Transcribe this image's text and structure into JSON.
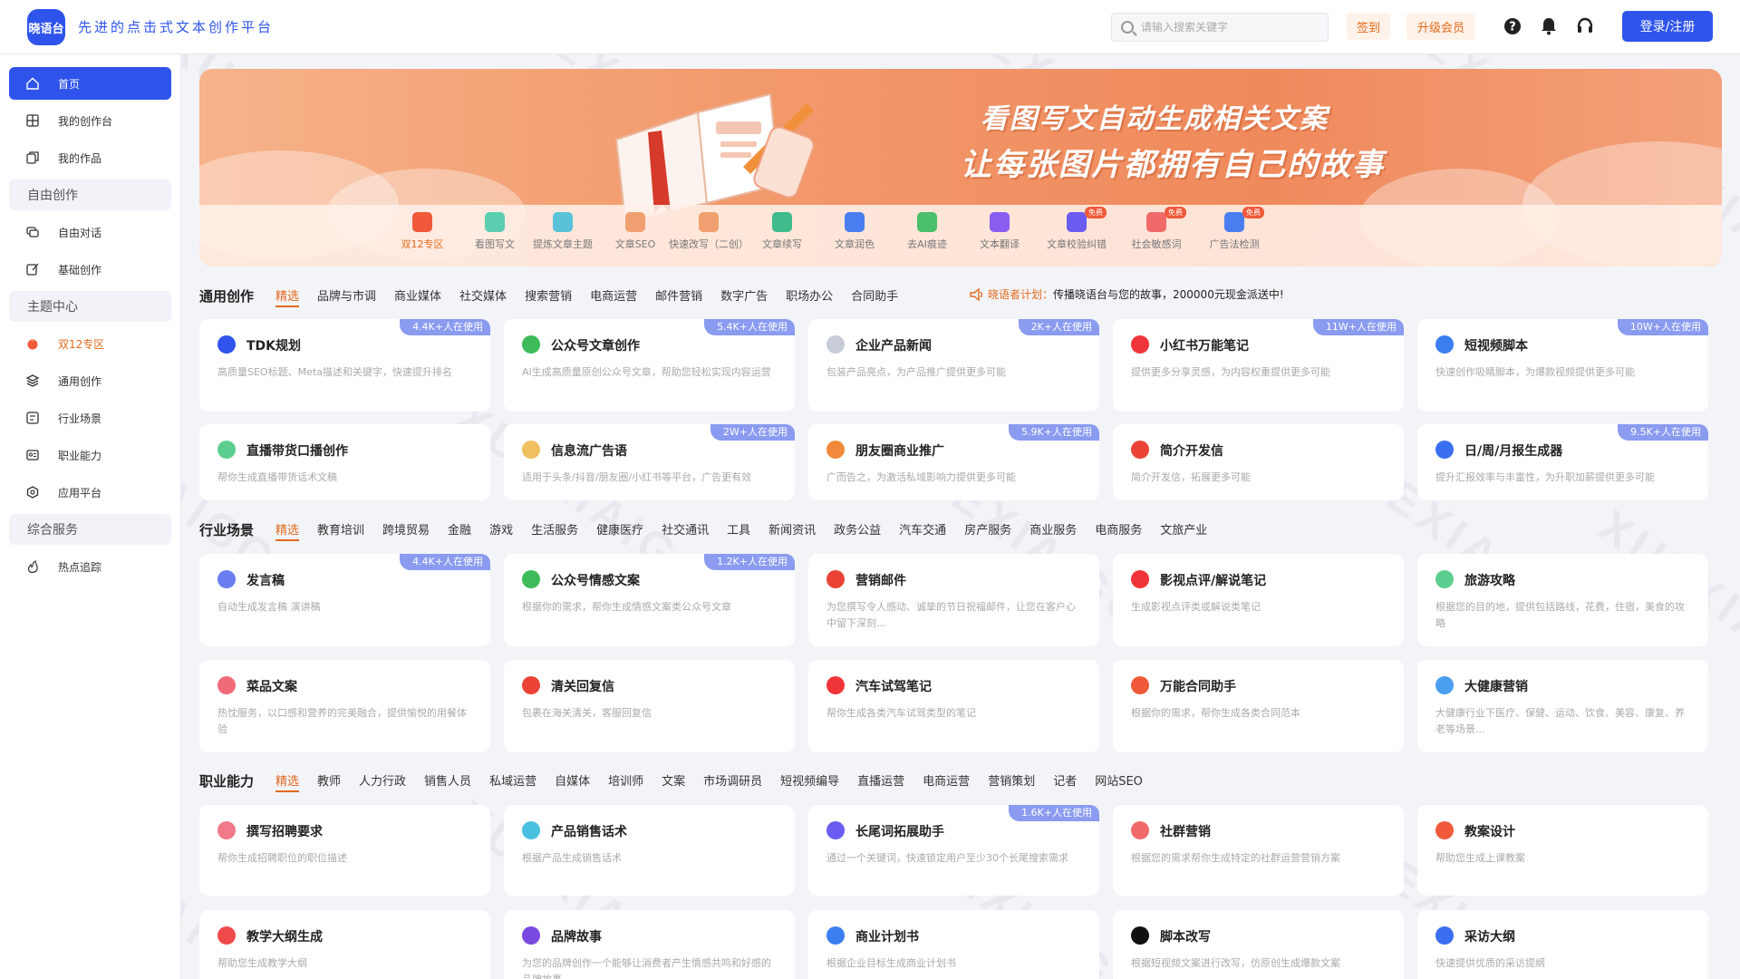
{
  "header": {
    "logo_text": "晓语台",
    "slogan": "先进的点击式文本创作平台",
    "search_placeholder": "请输入搜索关键字",
    "sign_label": "签到",
    "vip_label": "升级会员",
    "login_label": "登录/注册"
  },
  "sidebar": {
    "home": "首页",
    "my_workbench": "我的创作台",
    "my_works": "我的作品",
    "group_free": "自由创作",
    "free_chat": "自由对话",
    "basic_create": "基础创作",
    "group_theme": "主题中心",
    "double12": "双12专区",
    "general_create": "通用创作",
    "industry": "行业场景",
    "profession": "职业能力",
    "apps": "应用平台",
    "group_service": "综合服务",
    "hot_track": "热点追踪"
  },
  "banner": {
    "title_line1": "看图写文自动生成相关文案",
    "title_line2": "让每张图片都拥有自己的故事",
    "tools": [
      {
        "label": "双12专区",
        "color": "#f05a3a"
      },
      {
        "label": "看图写文",
        "color": "#5ccfb0"
      },
      {
        "label": "提炼文章主题",
        "color": "#59c2d8"
      },
      {
        "label": "文章SEO",
        "color": "#f0a070"
      },
      {
        "label": "快速改写（二创）",
        "color": "#f0a070"
      },
      {
        "label": "文章续写",
        "color": "#3dbb8a"
      },
      {
        "label": "文章润色",
        "color": "#4a7ef0"
      },
      {
        "label": "去AI痕迹",
        "color": "#4cbf6a"
      },
      {
        "label": "文本翻译",
        "color": "#8a5cf0"
      },
      {
        "label": "文章校验纠错",
        "color": "#6a5cf0"
      },
      {
        "label": "社会敏感词",
        "color": "#f06a6a"
      },
      {
        "label": "广告法检测",
        "color": "#4a7ef0"
      }
    ],
    "free_label": "免费"
  },
  "general": {
    "title": "通用创作",
    "tabs": [
      "精选",
      "品牌与市调",
      "商业媒体",
      "社交媒体",
      "搜索营销",
      "电商运营",
      "邮件营销",
      "数字广告",
      "职场办公",
      "合同助手"
    ],
    "notice_prefix": "晓语者计划：",
    "notice_text": "传播晓语台与您的故事，200000元现金派送中!",
    "cards": [
      {
        "title": "TDK规划",
        "desc": "高质量SEO标题、Meta描述和关键字，快速提升排名",
        "badge": "4.4K+人在使用",
        "icon_color": "#2f54eb"
      },
      {
        "title": "公众号文章创作",
        "desc": "AI生成高质量原创公众号文章，帮助您轻松实现内容运营",
        "badge": "5.4K+人在使用",
        "icon_color": "#3dbb5a"
      },
      {
        "title": "企业产品新闻",
        "desc": "包装产品亮点，为产品推广提供更多可能",
        "badge": "2K+人在使用",
        "icon_color": "#c8ccd8"
      },
      {
        "title": "小红书万能笔记",
        "desc": "提供更多分享灵感，为内容权重提供更多可能",
        "badge": "11W+人在使用",
        "icon_color": "#f0353a"
      },
      {
        "title": "短视频脚本",
        "desc": "快速创作吸睛脚本，为爆款视频提供更多可能",
        "badge": "10W+人在使用",
        "icon_color": "#3a7ef0"
      },
      {
        "title": "直播带货口播创作",
        "desc": "帮你生成直播带货话术文稿",
        "badge": "",
        "icon_color": "#5ccf90"
      },
      {
        "title": "信息流广告语",
        "desc": "适用于头条/抖音/朋友圈/小红书等平台，广告更有效",
        "badge": "2W+人在使用",
        "icon_color": "#f0c060"
      },
      {
        "title": "朋友圈商业推广",
        "desc": "广而告之，为激活私域影响力提供更多可能",
        "badge": "5.9K+人在使用",
        "icon_color": "#f08a3a"
      },
      {
        "title": "简介开发信",
        "desc": "简介开发信，拓展更多可能",
        "badge": "",
        "icon_color": "#ea4335"
      },
      {
        "title": "日/周/月报生成器",
        "desc": "提升汇报效率与丰富性，为升职加薪提供更多可能",
        "badge": "9.5K+人在使用",
        "icon_color": "#3a6ef0"
      }
    ]
  },
  "industry": {
    "title": "行业场景",
    "tabs": [
      "精选",
      "教育培训",
      "跨境贸易",
      "金融",
      "游戏",
      "生活服务",
      "健康医疗",
      "社交通讯",
      "工具",
      "新闻资讯",
      "政务公益",
      "汽车交通",
      "房产服务",
      "商业服务",
      "电商服务",
      "文旅产业"
    ],
    "cards": [
      {
        "title": "发言稿",
        "desc": "自动生成发言稿 演讲稿",
        "badge": "4.4K+人在使用",
        "icon_color": "#6a7ef0"
      },
      {
        "title": "公众号情感文案",
        "desc": "根据你的需求，帮你生成情感文案类公众号文章",
        "badge": "1.2K+人在使用",
        "icon_color": "#3dbb5a"
      },
      {
        "title": "营销邮件",
        "desc": "为您撰写令人感动、诚挚的节日祝福邮件，让您在客户心中留下深刻...",
        "badge": "",
        "icon_color": "#ea4335"
      },
      {
        "title": "影视点评/解说笔记",
        "desc": "生成影视点评类或解说类笔记",
        "badge": "",
        "icon_color": "#f0353a"
      },
      {
        "title": "旅游攻略",
        "desc": "根据您的目的地，提供包括路线，花费，住宿，美食的攻略",
        "badge": "",
        "icon_color": "#5ccf90"
      },
      {
        "title": "菜品文案",
        "desc": "热忱服务，以口感和营养的完美融合，提供愉悦的用餐体验",
        "badge": "",
        "icon_color": "#f06a7a"
      },
      {
        "title": "清关回复信",
        "desc": "包裹在海关清关，客服回复信",
        "badge": "",
        "icon_color": "#ea4335"
      },
      {
        "title": "汽车试驾笔记",
        "desc": "帮你生成各类汽车试驾类型的笔记",
        "badge": "",
        "icon_color": "#f0353a"
      },
      {
        "title": "万能合同助手",
        "desc": "根据你的需求，帮你生成各类合同范本",
        "badge": "",
        "icon_color": "#f05a3a"
      },
      {
        "title": "大健康营销",
        "desc": "大健康行业下医疗、保健、运动、饮食、美容、康复、养老等场景...",
        "badge": "",
        "icon_color": "#4a9ef0"
      }
    ]
  },
  "profession": {
    "title": "职业能力",
    "tabs": [
      "精选",
      "教师",
      "人力行政",
      "销售人员",
      "私域运营",
      "自媒体",
      "培训师",
      "文案",
      "市场调研员",
      "短视频编导",
      "直播运营",
      "电商运营",
      "营销策划",
      "记者",
      "网站SEO"
    ],
    "cards": [
      {
        "title": "撰写招聘要求",
        "desc": "帮你生成招聘职位的职位描述",
        "badge": "",
        "icon_color": "#f07a8a"
      },
      {
        "title": "产品销售话术",
        "desc": "根据产品生成销售话术",
        "badge": "",
        "icon_color": "#4ac0e0"
      },
      {
        "title": "长尾词拓展助手",
        "desc": "通过一个关键词，快速锁定用户至少30个长尾搜索需求",
        "badge": "1.6K+人在使用",
        "icon_color": "#6a5cf0"
      },
      {
        "title": "社群营销",
        "desc": "根据您的需求帮你生成特定的社群运营营销方案",
        "badge": "",
        "icon_color": "#f06a6a"
      },
      {
        "title": "教案设计",
        "desc": "帮助您生成上课教案",
        "badge": "",
        "icon_color": "#f05a3a"
      },
      {
        "title": "教学大纲生成",
        "desc": "帮助您生成教学大纲",
        "badge": "",
        "icon_color": "#f04a4a"
      },
      {
        "title": "品牌故事",
        "desc": "为您的品牌创作一个能够让消费者产生情感共鸣和好感的品牌故事",
        "badge": "",
        "icon_color": "#7a4ae0"
      },
      {
        "title": "商业计划书",
        "desc": "根据企业目标生成商业计划书",
        "badge": "",
        "icon_color": "#3a7ef0"
      },
      {
        "title": "脚本改写",
        "desc": "根据短视频文案进行改写，仿原创生成爆款文案",
        "badge": "",
        "icon_color": "#111111"
      },
      {
        "title": "采访大纲",
        "desc": "快速提供优质的采访提纲",
        "badge": "",
        "icon_color": "#3a6ef0"
      }
    ]
  },
  "watermark": "XUEXIAIGC"
}
